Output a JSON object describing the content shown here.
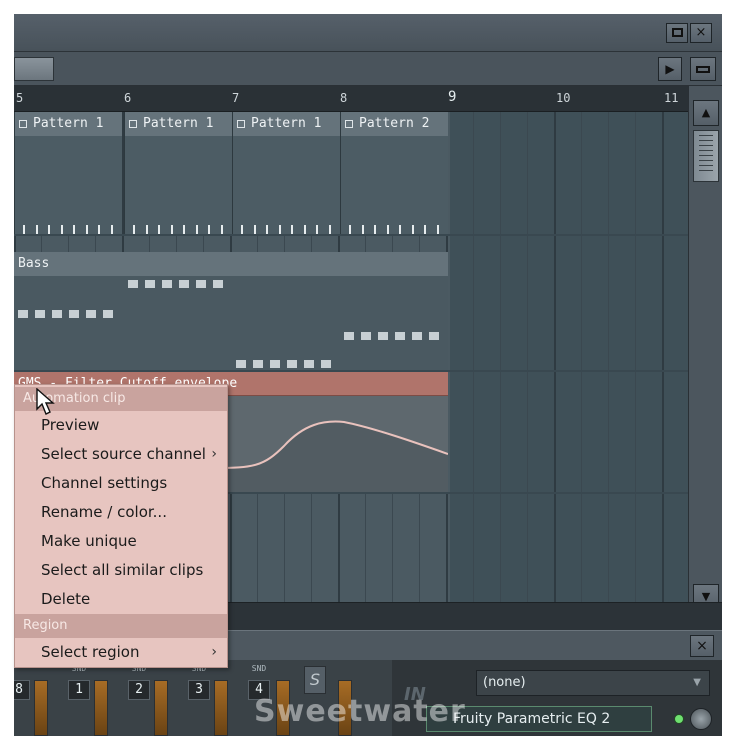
{
  "ruler": {
    "bars": [
      "5",
      "6",
      "7",
      "8",
      "9",
      "10",
      "11"
    ]
  },
  "patterns": [
    {
      "label": "Pattern 1"
    },
    {
      "label": "Pattern 1"
    },
    {
      "label": "Pattern 1"
    },
    {
      "label": "Pattern 2"
    }
  ],
  "bass_clip": {
    "label": "Bass"
  },
  "automation_clip": {
    "label": "GMS - Filter Cutoff envelope"
  },
  "context_menu": {
    "section_header": "Automation clip",
    "items": [
      {
        "label": "Preview"
      },
      {
        "label": "Select source channel",
        "submenu": "›"
      },
      {
        "label": "Channel settings"
      },
      {
        "label": "Rename / color..."
      },
      {
        "label": "Make unique"
      },
      {
        "label": "Select all similar clips"
      },
      {
        "label": "Delete"
      }
    ],
    "region_header": "Region",
    "region_items": [
      {
        "label": "Select region",
        "submenu": "›"
      }
    ]
  },
  "mixer": {
    "strips": [
      {
        "label": "",
        "num": "8"
      },
      {
        "label": "SND",
        "num": "1"
      },
      {
        "label": "SND",
        "num": "2"
      },
      {
        "label": "SND",
        "num": "3"
      },
      {
        "label": "SND",
        "num": "4"
      }
    ],
    "s_button": "S",
    "fx_logo": "IN",
    "input_select": "(none)",
    "effect_slot": "Fruity Parametric EQ 2",
    "dropdown_arrow": "▼"
  },
  "watermark": "Sweetwater",
  "colors": {
    "automation_clip": "#b0746b",
    "context_menu_bg": "#e7c5c0",
    "grid_bg": "#4b5a62"
  },
  "icons": {
    "window_close": "×",
    "scroll_right": "▶",
    "scroll_up": "▲",
    "scroll_down": "▼"
  }
}
